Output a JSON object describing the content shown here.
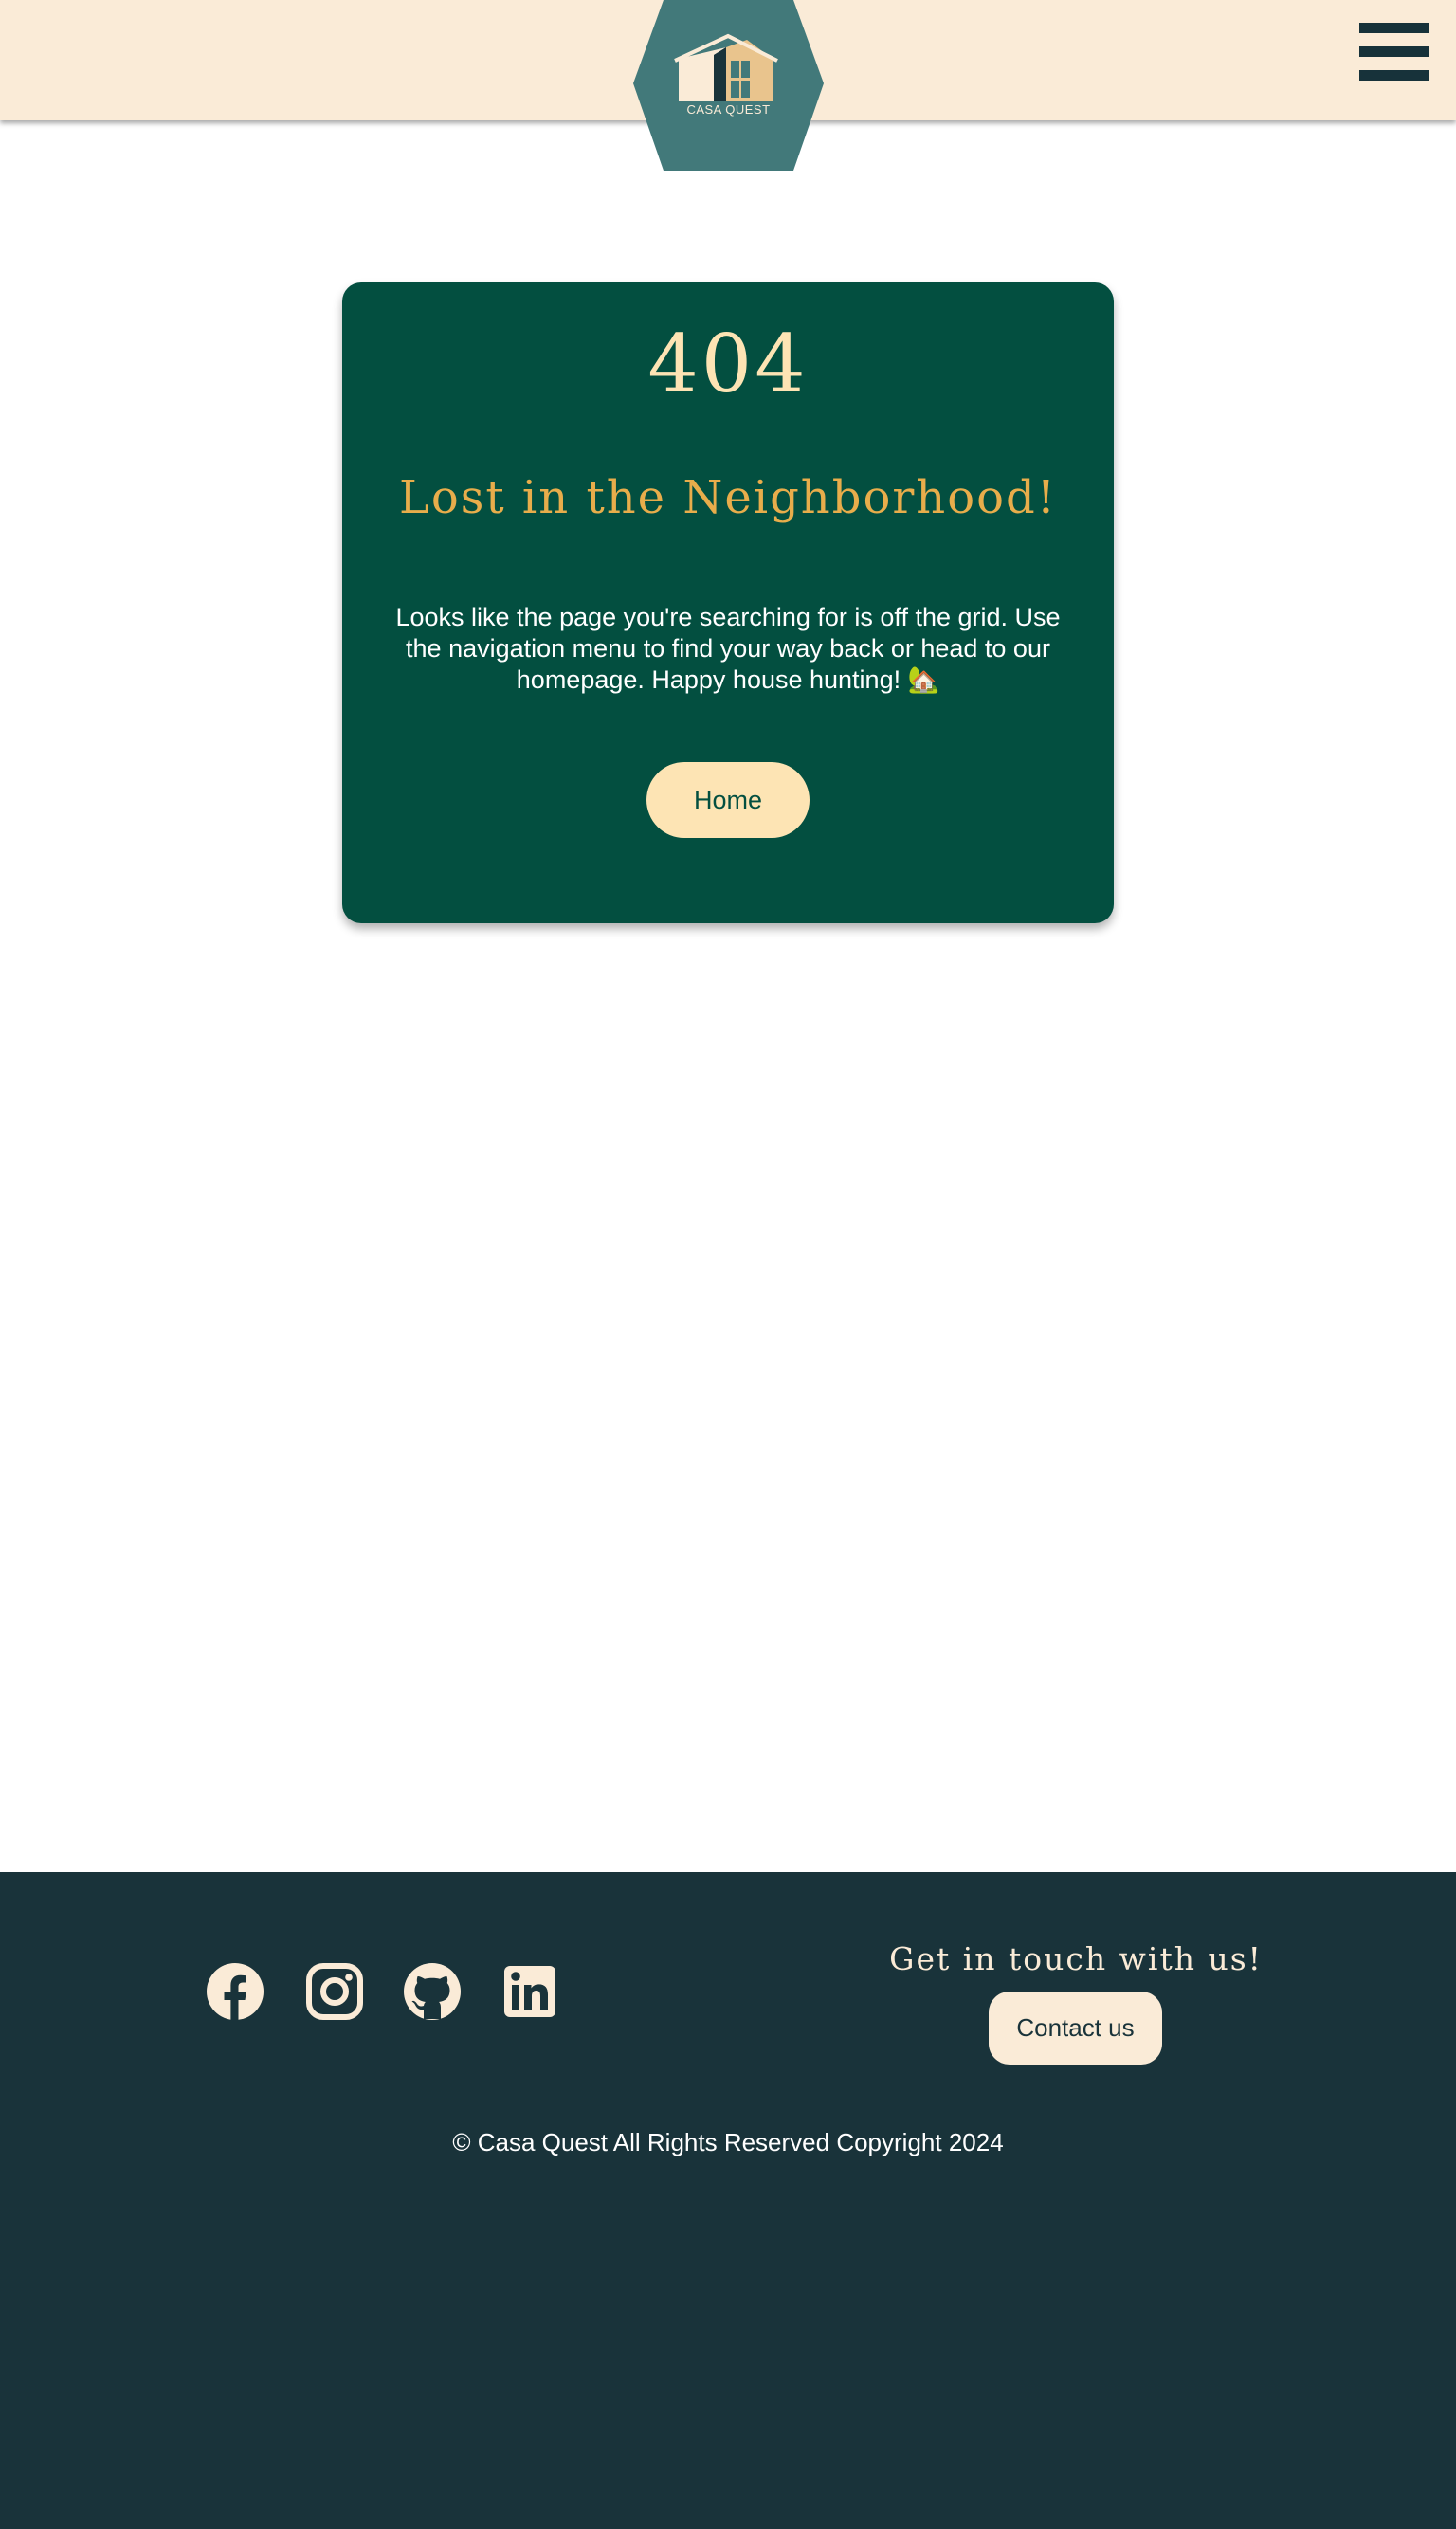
{
  "header": {
    "logo_text": "CASA QUEST",
    "menu_icon": "hamburger-menu-icon"
  },
  "error": {
    "code": "404",
    "title": "Lost in the Neighborhood!",
    "message": "Looks like the page you're searching for is off the grid. Use the navigation menu to find your way back or head to our homepage. Happy house hunting! 🏡",
    "home_button": "Home"
  },
  "footer": {
    "social_icons": [
      "facebook-icon",
      "instagram-icon",
      "github-icon",
      "linkedin-icon"
    ],
    "touch_text": "Get in touch with us!",
    "contact_button": "Contact us",
    "copyright": "© Casa Quest All Rights Reserved Copyright 2024"
  },
  "colors": {
    "header_bg": "#faebd7",
    "card_bg": "#034f40",
    "accent": "#e8ad4b",
    "cream": "#fde4b4",
    "footer_bg": "#19333a",
    "logo_teal": "#42797a"
  }
}
